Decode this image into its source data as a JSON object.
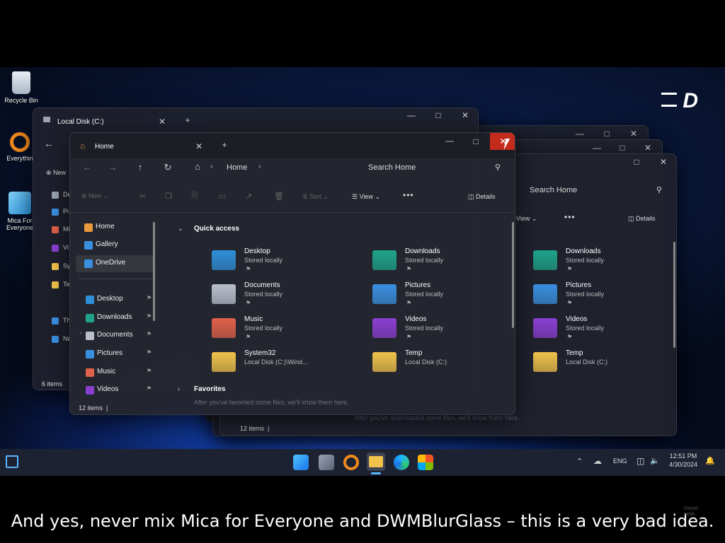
{
  "desktop_icons": [
    {
      "label": "Recycle Bin",
      "icon": "recycle-bin-icon"
    },
    {
      "label": "Everythin",
      "icon": "search-app-icon"
    },
    {
      "label": "Mica For Everyone",
      "icon": "mica-app-icon"
    }
  ],
  "back_window": {
    "tab": "Local Disk (C:)",
    "new_label": "New",
    "items_status": "6 items",
    "side_items": [
      "De",
      "Pi",
      "Mi",
      "Vi",
      "Sy",
      "Te",
      "Th",
      "Ne"
    ]
  },
  "right_window": {
    "search_placeholder": "Search Home",
    "view_label": "View",
    "details_label": "Details",
    "items_status": "12 items",
    "folders": [
      {
        "name": "Downloads",
        "sub": "Stored locally",
        "color": "#1fa38a"
      },
      {
        "name": "Pictures",
        "sub": "Stored locally",
        "color": "#3a8fe0"
      },
      {
        "name": "Videos",
        "sub": "Stored locally",
        "color": "#8a3fd1"
      },
      {
        "name": "Temp",
        "sub": "Local Disk (C:)",
        "color": "#f0c24b"
      }
    ],
    "faded_text": "After you've downloaded some files, we'll show them here."
  },
  "main_window": {
    "tab": "Home",
    "breadcrumb": "Home",
    "search_placeholder": "Search Home",
    "new_label": "New",
    "sort_label": "Sort",
    "view_label": "View",
    "more_label": "•••",
    "details_label": "Details",
    "items_status": "12 items",
    "sidebar": [
      {
        "label": "Home",
        "color": "#e89a3c",
        "pin": false
      },
      {
        "label": "Gallery",
        "color": "#3a8fe0",
        "pin": false
      },
      {
        "label": "OneDrive",
        "color": "#3a8fe0",
        "pin": false
      },
      {
        "label": "Desktop",
        "color": "#2e8fd8",
        "pin": true
      },
      {
        "label": "Downloads",
        "color": "#1fa38a",
        "pin": true
      },
      {
        "label": "Documents",
        "color": "#b9c0cc",
        "pin": true
      },
      {
        "label": "Pictures",
        "color": "#3a8fe0",
        "pin": true
      },
      {
        "label": "Music",
        "color": "#e0614a",
        "pin": true
      },
      {
        "label": "Videos",
        "color": "#8a3fd1",
        "pin": true
      }
    ],
    "quick_access_label": "Quick access",
    "favorites_label": "Favorites",
    "favorites_hint": "After you've favorited some files, we'll show them here.",
    "folders": [
      {
        "name": "Desktop",
        "sub": "Stored locally",
        "color": "#2e8fd8",
        "pin": true
      },
      {
        "name": "Downloads",
        "sub": "Stored locally",
        "color": "#1fa38a",
        "pin": true
      },
      {
        "name": "Documents",
        "sub": "Stored locally",
        "color": "#b9c0cc",
        "pin": true
      },
      {
        "name": "Pictures",
        "sub": "Stored locally",
        "color": "#3a8fe0",
        "pin": true
      },
      {
        "name": "Music",
        "sub": "Stored locally",
        "color": "#e0614a",
        "pin": true
      },
      {
        "name": "Videos",
        "sub": "Stored locally",
        "color": "#8a3fd1",
        "pin": true
      },
      {
        "name": "System32",
        "sub": "Local Disk (C:)\\Wind...",
        "color": "#f0c24b",
        "pin": false
      },
      {
        "name": "Temp",
        "sub": "Local Disk (C:)",
        "color": "#f0c24b",
        "pin": false
      }
    ]
  },
  "taskbar": {
    "lang": "ENG",
    "time": "12:51 PM",
    "date": "4/30/2024",
    "apps": [
      "start-icon",
      "task-view-icon",
      "everything-search-icon",
      "file-explorer-icon",
      "edge-icon",
      "store-icon"
    ]
  },
  "caption": "And yes, never mix Mica for Everyone and DWMBlurGlass – this is a very bad idea.",
  "watermark": "Daniel\nwells",
  "logo_text": "D"
}
